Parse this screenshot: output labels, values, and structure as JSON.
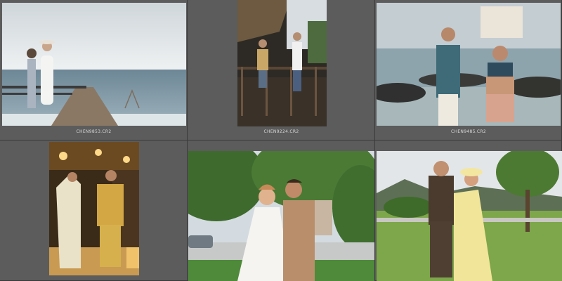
{
  "grid": {
    "cells": [
      {
        "filename": "CHEN9853.CR2",
        "subject": "couple on wooden pier by the sea"
      },
      {
        "filename": "CHEN9224.CR2",
        "subject": "couple under thatched hut balcony"
      },
      {
        "filename": "CHEN9485.CR2",
        "subject": "couple on rocky beach holding lace scarf"
      },
      {
        "filename": "",
        "subject": "couple in warm-lit bar"
      },
      {
        "filename": "",
        "subject": "groom kissing bride under trees"
      },
      {
        "filename": "",
        "subject": "couple on lawn with hills"
      }
    ]
  },
  "colors": {
    "background": "#4a4a4a",
    "cell": "#5c5c5c",
    "label": "#d8d8d8"
  }
}
